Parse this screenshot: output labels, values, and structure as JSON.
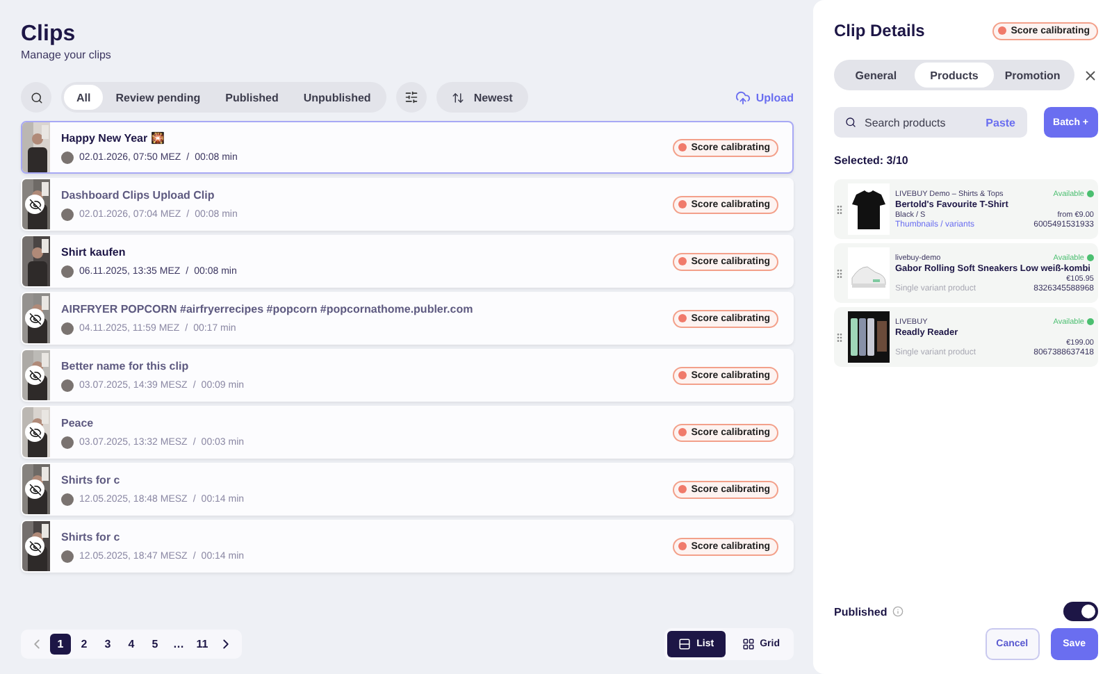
{
  "header": {
    "title": "Clips",
    "subtitle": "Manage your clips"
  },
  "filters": [
    {
      "label": "All",
      "selected": true
    },
    {
      "label": "Review pending",
      "selected": false
    },
    {
      "label": "Published",
      "selected": false
    },
    {
      "label": "Unpublished",
      "selected": false
    }
  ],
  "sort": {
    "label": "Newest"
  },
  "upload": {
    "label": "Upload"
  },
  "meta_separator": "/",
  "clips": [
    {
      "title": "Happy New Year 🎇",
      "date": "02.01.2026, 07:50 MEZ",
      "duration": "00:08 min",
      "status": "Score calibrating",
      "published": true,
      "selected": true
    },
    {
      "title": "Dashboard Clips Upload Clip",
      "date": "02.01.2026, 07:04 MEZ",
      "duration": "00:08 min",
      "status": "Score calibrating",
      "published": false,
      "selected": false
    },
    {
      "title": "Shirt kaufen",
      "date": "06.11.2025, 13:35 MEZ",
      "duration": "00:08 min",
      "status": "Score calibrating",
      "published": true,
      "selected": false
    },
    {
      "title": "AIRFRYER POPCORN #airfryerrecipes #popcorn #popcornathome.publer.com",
      "date": "04.11.2025, 11:59 MEZ",
      "duration": "00:17 min",
      "status": "Score calibrating",
      "published": false,
      "selected": false
    },
    {
      "title": "Better name for this clip",
      "date": "03.07.2025, 14:39 MESZ",
      "duration": "00:09 min",
      "status": "Score calibrating",
      "published": false,
      "selected": false
    },
    {
      "title": "Peace",
      "date": "03.07.2025, 13:32 MESZ",
      "duration": "00:03 min",
      "status": "Score calibrating",
      "published": false,
      "selected": false
    },
    {
      "title": "Shirts for c",
      "date": "12.05.2025, 18:48 MESZ",
      "duration": "00:14 min",
      "status": "Score calibrating",
      "published": false,
      "selected": false
    },
    {
      "title": "Shirts for c",
      "date": "12.05.2025, 18:47 MESZ",
      "duration": "00:14 min",
      "status": "Score calibrating",
      "published": false,
      "selected": false
    }
  ],
  "pagination": {
    "pages": [
      {
        "label": "1",
        "selected": true
      },
      {
        "label": "2",
        "selected": false
      },
      {
        "label": "3",
        "selected": false
      },
      {
        "label": "4",
        "selected": false
      },
      {
        "label": "5",
        "selected": false
      },
      {
        "label": "…",
        "selected": false
      },
      {
        "label": "11",
        "selected": false
      }
    ]
  },
  "views": [
    {
      "label": "List",
      "selected": true
    },
    {
      "label": "Grid",
      "selected": false
    }
  ],
  "details": {
    "title": "Clip Details",
    "status": "Score calibrating",
    "tabs": [
      {
        "label": "General",
        "selected": false
      },
      {
        "label": "Products",
        "selected": true
      },
      {
        "label": "Promotion",
        "selected": false
      }
    ],
    "search": {
      "placeholder": "Search products",
      "paste": "Paste",
      "batch": "Batch +"
    },
    "selected_count": "Selected: 3/10",
    "products": [
      {
        "vendor": "LIVEBUY Demo – Shirts & Tops",
        "name": "Bertold's Favourite T-Shirt",
        "variant": "Black / S",
        "price": "from €9.00",
        "variants": "Thumbnails / variants",
        "sku": "6005491531933",
        "availability": "Available",
        "kind": "shirt",
        "multi": true
      },
      {
        "vendor": "livebuy-demo",
        "name": "Gabor Rolling Soft Sneakers Low weiß-kombi",
        "price": "€105.95",
        "variants": "Single variant product",
        "sku": "8326345588968",
        "availability": "Available",
        "kind": "shoe",
        "multi": false
      },
      {
        "vendor": "LIVEBUY",
        "name": "Readly Reader",
        "price": "€199.00",
        "variants": "Single variant product",
        "sku": "8067388637418",
        "availability": "Available",
        "kind": "phones",
        "multi": false
      }
    ],
    "published": {
      "label": "Published",
      "on": true
    },
    "cancel": "Cancel",
    "save": "Save"
  }
}
